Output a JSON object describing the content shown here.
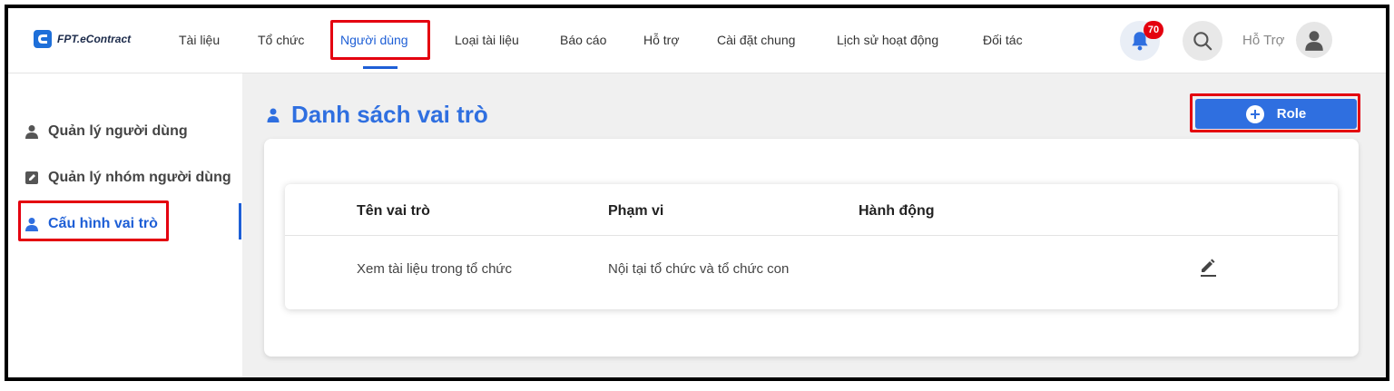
{
  "app": {
    "logo_text": "FPT.eContract",
    "accent": "#2f6fe0",
    "highlight": "#e4000f"
  },
  "nav": {
    "items": [
      {
        "label": "Tài liệu",
        "active": false
      },
      {
        "label": "Tổ chức",
        "active": false
      },
      {
        "label": "Người dùng",
        "active": true
      },
      {
        "label": "Loại tài liệu",
        "active": false
      },
      {
        "label": "Báo cáo",
        "active": false
      },
      {
        "label": "Hỗ trợ",
        "active": false
      },
      {
        "label": "Cài đặt chung",
        "active": false
      },
      {
        "label": "Lịch sử hoạt động",
        "active": false
      },
      {
        "label": "Đối tác",
        "active": false
      }
    ],
    "notification_count": "70",
    "support_label": "Hỗ Trợ",
    "icons": [
      "bell-icon",
      "search-icon",
      "user-avatar-icon"
    ]
  },
  "sidebar": {
    "items": [
      {
        "label": "Quản lý người dùng",
        "icon": "user-icon",
        "active": false
      },
      {
        "label": "Quản lý nhóm người dùng",
        "icon": "edit-document-icon",
        "active": false
      },
      {
        "label": "Cấu hình vai trò",
        "icon": "user-icon",
        "active": true
      }
    ]
  },
  "main": {
    "title": "Danh sách vai trò",
    "add_button_label": "Role",
    "table": {
      "headers": [
        "Tên vai trò",
        "Phạm vi",
        "Hành động"
      ],
      "rows": [
        {
          "name": "Xem tài liệu trong tổ chức",
          "scope": "Nội tại tổ chức và tổ chức con",
          "action_icon": "pencil-icon"
        }
      ]
    }
  }
}
